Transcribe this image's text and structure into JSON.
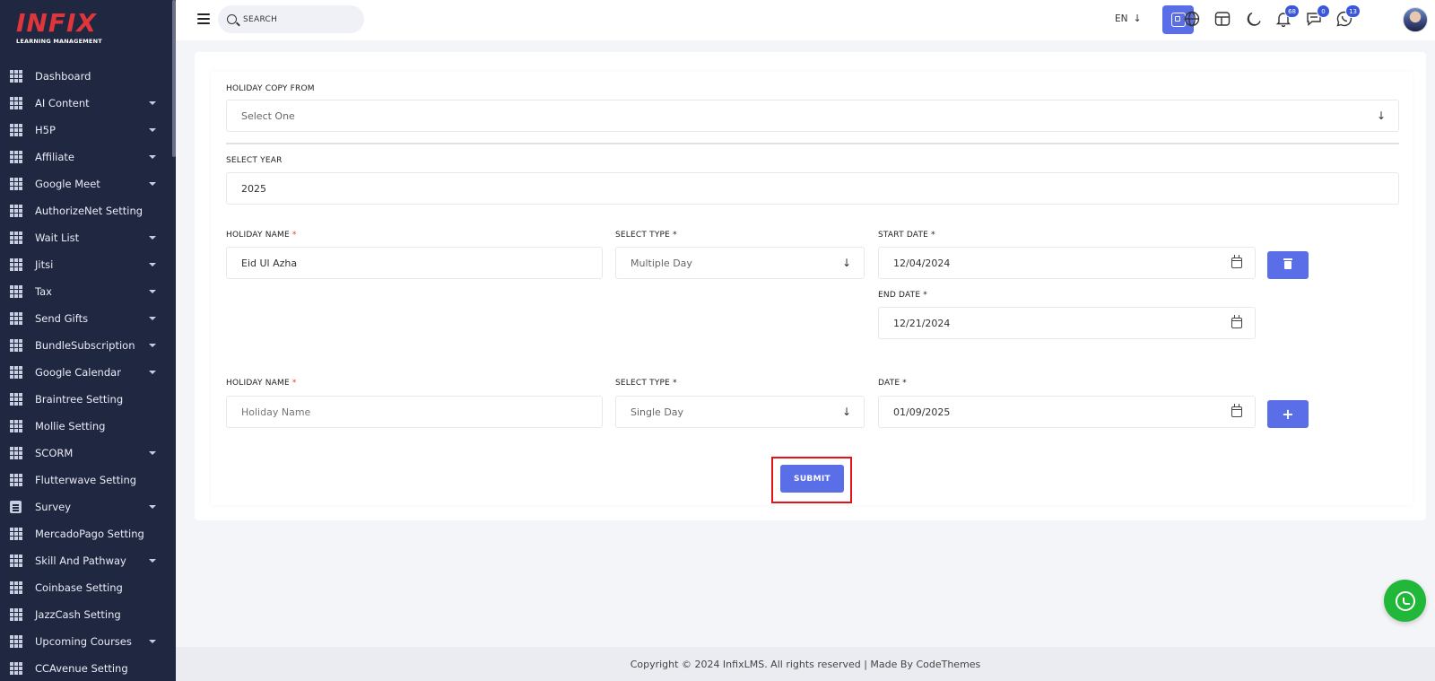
{
  "brand": {
    "logo_text": "INFIX",
    "logo_sub": "LEARNING MANAGEMENT",
    "accent": "#5a6ee8",
    "sidebar_bg": "#202740",
    "logo_color": "#e0353b"
  },
  "sidebar": {
    "items": [
      {
        "label": "Dashboard",
        "icon": "grid-icon",
        "caret": false
      },
      {
        "label": "AI Content",
        "icon": "grid-icon",
        "caret": true
      },
      {
        "label": "H5P",
        "icon": "grid-icon",
        "caret": true
      },
      {
        "label": "Affiliate",
        "icon": "grid-icon",
        "caret": true
      },
      {
        "label": "Google Meet",
        "icon": "grid-icon",
        "caret": true
      },
      {
        "label": "AuthorizeNet Setting",
        "icon": "grid-icon",
        "caret": false
      },
      {
        "label": "Wait List",
        "icon": "grid-icon",
        "caret": true
      },
      {
        "label": "Jitsi",
        "icon": "grid-icon",
        "caret": true
      },
      {
        "label": "Tax",
        "icon": "grid-icon",
        "caret": true
      },
      {
        "label": "Send Gifts",
        "icon": "grid-icon",
        "caret": true
      },
      {
        "label": "BundleSubscription",
        "icon": "grid-icon",
        "caret": true
      },
      {
        "label": "Google Calendar",
        "icon": "grid-icon",
        "caret": true
      },
      {
        "label": "Braintree Setting",
        "icon": "grid-icon",
        "caret": false
      },
      {
        "label": "Mollie Setting",
        "icon": "grid-icon",
        "caret": false
      },
      {
        "label": "SCORM",
        "icon": "grid-icon",
        "caret": true
      },
      {
        "label": "Flutterwave Setting",
        "icon": "grid-icon",
        "caret": false
      },
      {
        "label": "Survey",
        "icon": "document-icon",
        "caret": true
      },
      {
        "label": "MercadoPago Setting",
        "icon": "grid-icon",
        "caret": false
      },
      {
        "label": "Skill And Pathway",
        "icon": "grid-icon",
        "caret": true
      },
      {
        "label": "Coinbase Setting",
        "icon": "grid-icon",
        "caret": false
      },
      {
        "label": "JazzCash Setting",
        "icon": "grid-icon",
        "caret": false
      },
      {
        "label": "Upcoming Courses",
        "icon": "grid-icon",
        "caret": true
      },
      {
        "label": "CCAvenue Setting",
        "icon": "grid-icon",
        "caret": false
      }
    ]
  },
  "header": {
    "search_placeholder": "SEARCH",
    "language": "EN",
    "notifications_count": "68",
    "messages_count": "0",
    "whatsapp_count": "13"
  },
  "form": {
    "copy_from": {
      "label": "HOLIDAY COPY FROM",
      "value": "Select One"
    },
    "year": {
      "label": "SELECT YEAR",
      "value": "2025"
    },
    "row1": {
      "name_label": "HOLIDAY NAME",
      "name_value": "Eid Ul Azha",
      "type_label": "SELECT TYPE",
      "type_value": "Multiple Day",
      "start_label": "START DATE",
      "start_value": "12/04/2024",
      "end_label": "END DATE",
      "end_value": "12/21/2024"
    },
    "row2": {
      "name_label": "HOLIDAY NAME",
      "name_placeholder": "Holiday Name",
      "type_label": "SELECT TYPE",
      "type_value": "Single Day",
      "date_label": "DATE",
      "date_value": "01/09/2025"
    },
    "required_mark": "*",
    "submit_label": "SUBMIT",
    "add_label": "+"
  },
  "footer": {
    "text": "Copyright © 2024 InfixLMS. All rights reserved | Made By CodeThemes"
  }
}
